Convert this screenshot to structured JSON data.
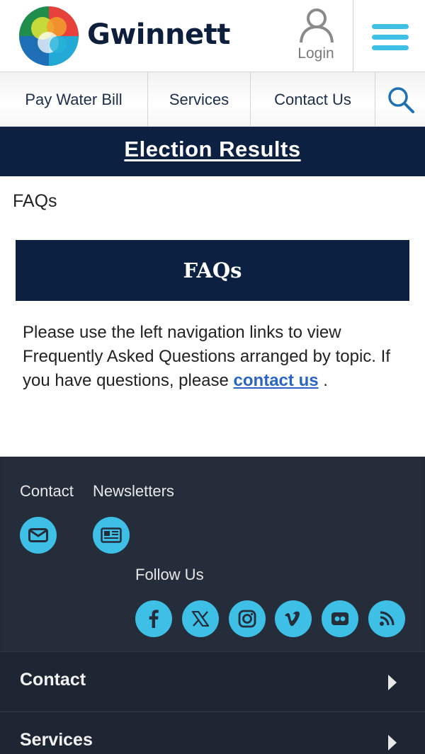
{
  "header": {
    "brand": "Gwinnett",
    "login_label": "Login"
  },
  "nav": {
    "items": [
      "Pay Water Bill",
      "Services",
      "Contact Us"
    ]
  },
  "banner": {
    "label": "Election Results"
  },
  "breadcrumb": "FAQs",
  "faq": {
    "title": "FAQs",
    "intro_text": "Please use the left navigation links to view Frequently Asked Questions arranged by topic. If you have questions, please ",
    "link_text": "contact us",
    "end_text": " ."
  },
  "footer": {
    "contact_label": "Contact",
    "newsletters_label": "Newsletters",
    "follow_label": "Follow Us",
    "social_icons": [
      "facebook-icon",
      "x-icon",
      "instagram-icon",
      "vimeo-icon",
      "flickr-icon",
      "rss-icon"
    ],
    "accordion": [
      "Contact",
      "Services"
    ]
  },
  "colors": {
    "navy": "#0c2142",
    "accent": "#3ebfe6",
    "link": "#2a64c4",
    "footer_bg": "#252c3a"
  }
}
